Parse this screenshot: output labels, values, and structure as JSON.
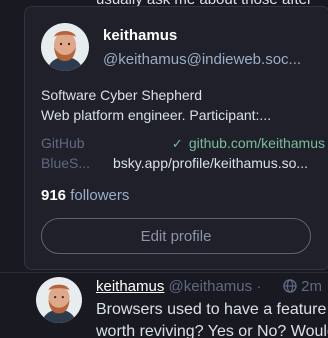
{
  "background": {
    "top_text": "usually ask me about those after"
  },
  "hover_card": {
    "display_name": "keithamus",
    "handle": "@keithamus@indieweb.soc...",
    "bio_line1": "Software Cyber Shepherd",
    "bio_line2": "Web platform engineer. Participant:...",
    "fields": [
      {
        "label": "GitHub",
        "value": "github.com/keithamus",
        "verified": true
      },
      {
        "label": "BlueS...",
        "value": "bsky.app/profile/keithamus.so...",
        "verified": false
      }
    ],
    "followers_count": "916",
    "followers_label": "followers",
    "edit_profile_label": "Edit profile"
  },
  "status": {
    "display_name": "keithamus",
    "handle": "@keithamus",
    "separator": "·",
    "time": "2m",
    "text_line1": "Browsers used to have a feature",
    "text_line2": "worth reviving? Yes or No? Would"
  },
  "colors": {
    "background": "#181921",
    "card": "#1f2029",
    "verified": "#79bd9a",
    "muted": "#606984"
  },
  "icons": {
    "verified": "check-icon",
    "visibility": "globe-icon"
  }
}
